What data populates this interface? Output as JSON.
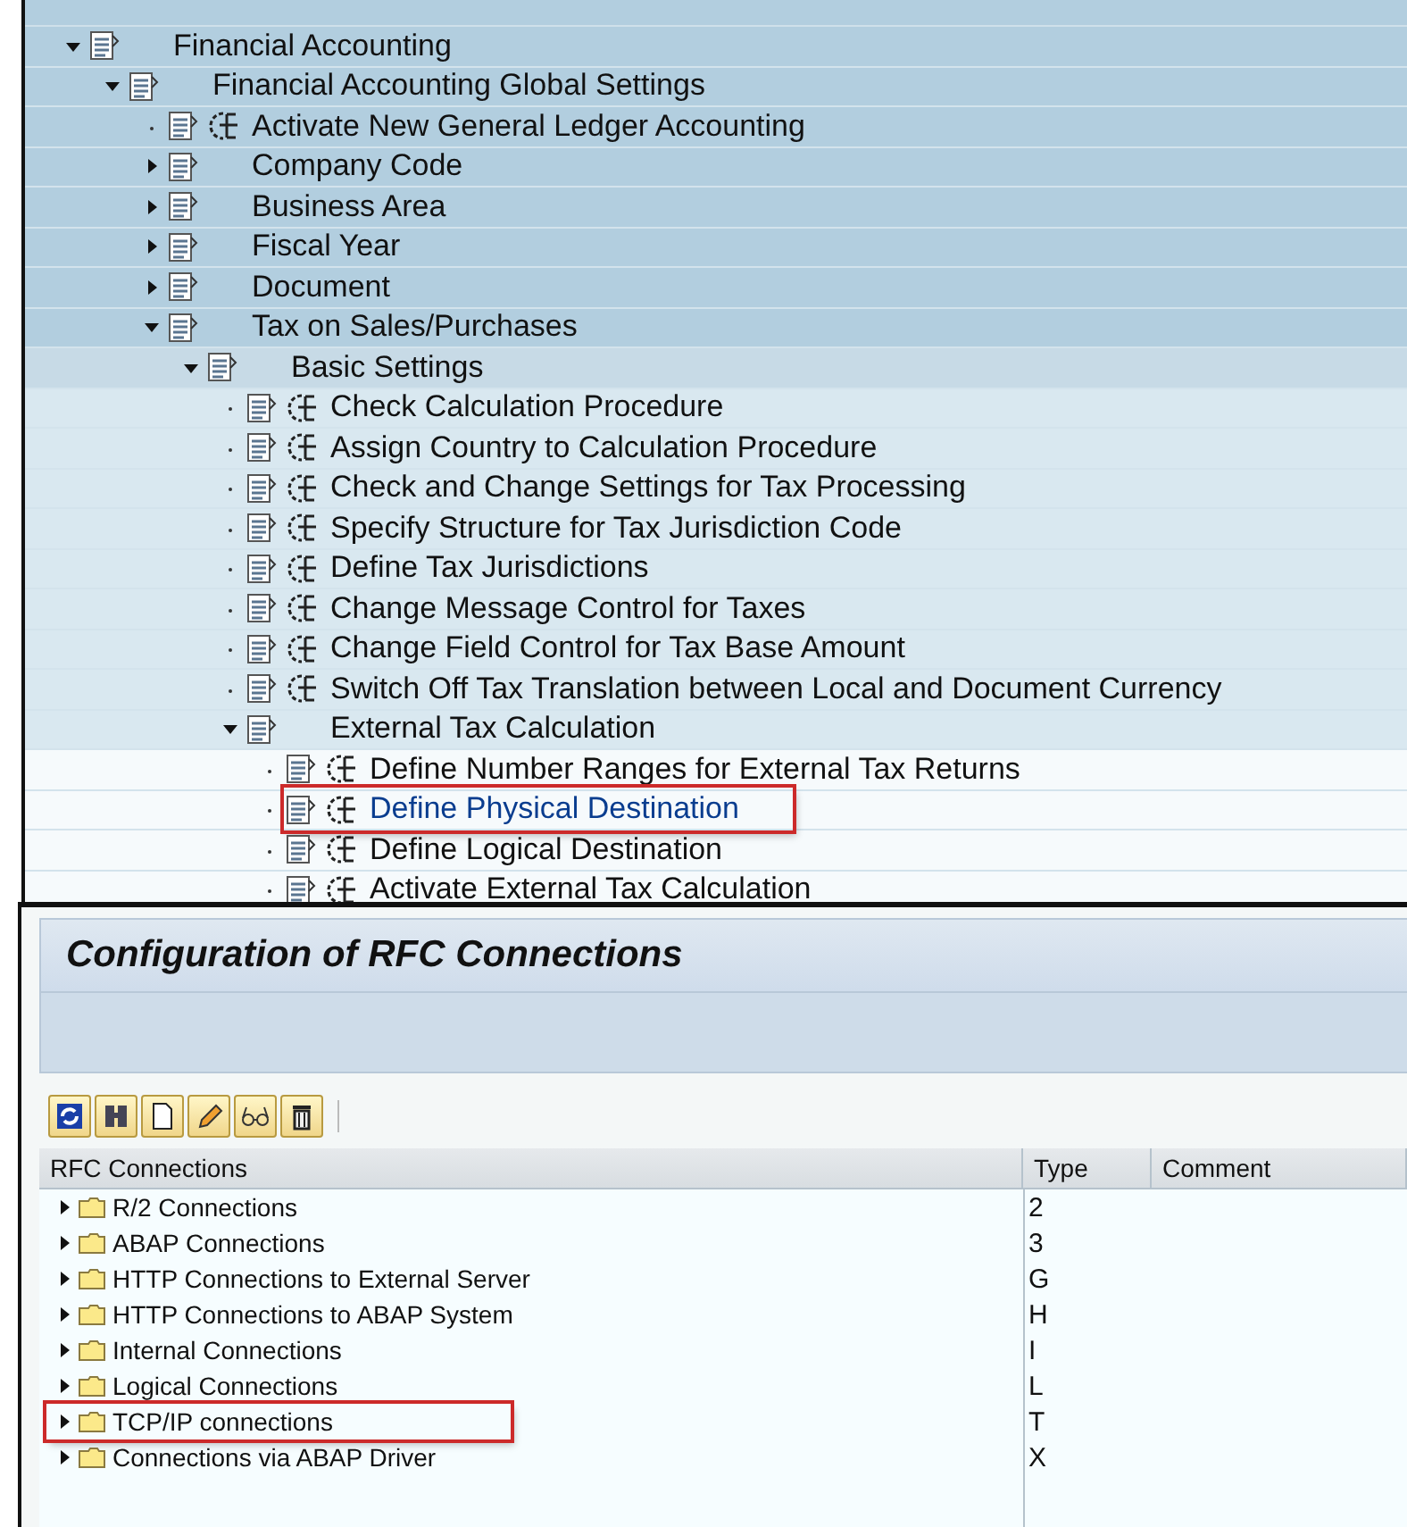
{
  "config_tree": {
    "items": [
      {
        "label": "Financial Accounting",
        "kind": "node",
        "expanded": true,
        "selected": false,
        "children": [
          {
            "label": "Financial Accounting Global Settings",
            "kind": "node",
            "expanded": true,
            "selected": false,
            "children": [
              {
                "label": "Activate New General Ledger Accounting",
                "kind": "activity",
                "selected": false
              },
              {
                "label": "Company Code",
                "kind": "node",
                "expanded": false,
                "selected": false
              },
              {
                "label": "Business Area",
                "kind": "node",
                "expanded": false,
                "selected": false
              },
              {
                "label": "Fiscal Year",
                "kind": "node",
                "expanded": false,
                "selected": false
              },
              {
                "label": "Document",
                "kind": "node",
                "expanded": false,
                "selected": false
              },
              {
                "label": "Tax on Sales/Purchases",
                "kind": "node",
                "expanded": true,
                "selected": false,
                "children": [
                  {
                    "label": "Basic Settings",
                    "kind": "node",
                    "expanded": true,
                    "selected": false,
                    "children": [
                      {
                        "label": "Check Calculation Procedure",
                        "kind": "activity",
                        "selected": false
                      },
                      {
                        "label": "Assign Country to Calculation Procedure",
                        "kind": "activity",
                        "selected": false
                      },
                      {
                        "label": "Check and Change Settings for Tax Processing",
                        "kind": "activity",
                        "selected": false
                      },
                      {
                        "label": "Specify Structure for Tax Jurisdiction Code",
                        "kind": "activity",
                        "selected": false
                      },
                      {
                        "label": "Define Tax Jurisdictions",
                        "kind": "activity",
                        "selected": false
                      },
                      {
                        "label": "Change Message Control for Taxes",
                        "kind": "activity",
                        "selected": false
                      },
                      {
                        "label": "Change Field Control for Tax Base Amount",
                        "kind": "activity",
                        "selected": false
                      },
                      {
                        "label": "Switch Off Tax Translation between Local and Document Currency",
                        "kind": "activity",
                        "selected": false
                      },
                      {
                        "label": "External Tax Calculation",
                        "kind": "node",
                        "expanded": true,
                        "selected": false,
                        "children": [
                          {
                            "label": "Define Number Ranges for External Tax Returns",
                            "kind": "activity",
                            "selected": false
                          },
                          {
                            "label": "Define Physical Destination",
                            "kind": "activity",
                            "selected": true
                          },
                          {
                            "label": "Define Logical Destination",
                            "kind": "activity",
                            "selected": false
                          },
                          {
                            "label": "Activate External Tax Calculation",
                            "kind": "activity",
                            "selected": false
                          }
                        ]
                      }
                    ]
                  }
                ]
              }
            ]
          }
        ]
      }
    ]
  },
  "rfc_screen": {
    "title": "Configuration of RFC Connections",
    "table": {
      "columns": [
        "RFC Connections",
        "Type",
        "Comment"
      ],
      "rows": [
        {
          "name": "R/2 Connections",
          "type": "2",
          "expanded": false,
          "selected": false
        },
        {
          "name": "ABAP Connections",
          "type": "3",
          "expanded": false,
          "selected": false
        },
        {
          "name": "HTTP Connections to External Server",
          "type": "G",
          "expanded": false,
          "selected": false
        },
        {
          "name": "HTTP Connections to ABAP System",
          "type": "H",
          "expanded": false,
          "selected": false
        },
        {
          "name": "Internal Connections",
          "type": "I",
          "expanded": false,
          "selected": false
        },
        {
          "name": "Logical Connections",
          "type": "L",
          "expanded": false,
          "selected": false
        },
        {
          "name": "TCP/IP connections",
          "type": "T",
          "expanded": false,
          "selected": true
        },
        {
          "name": "Connections via ABAP Driver",
          "type": "X",
          "expanded": false,
          "selected": false
        }
      ]
    }
  }
}
